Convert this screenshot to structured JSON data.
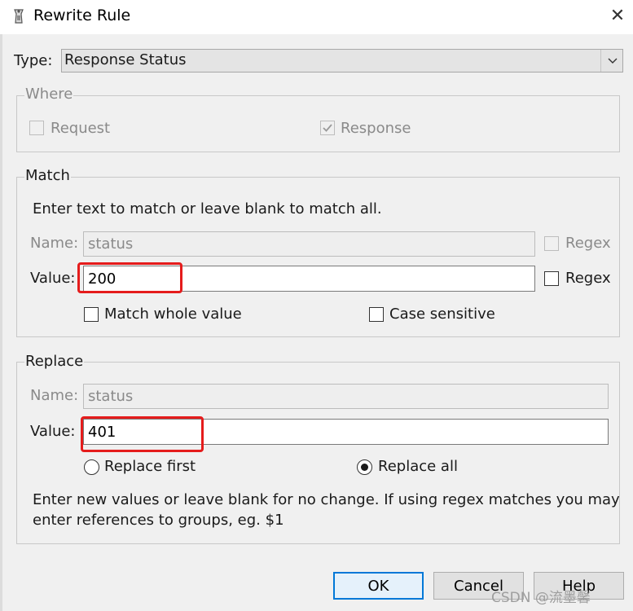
{
  "window": {
    "title": "Rewrite Rule",
    "icon": "wrench-app-icon"
  },
  "type": {
    "label": "Type:",
    "selected": "Response Status"
  },
  "where": {
    "title": "Where",
    "request_label": "Request",
    "request_checked": false,
    "response_label": "Response",
    "response_checked": true
  },
  "match": {
    "title": "Match",
    "hint": "Enter text to match or leave blank to match all.",
    "name_label": "Name:",
    "name_value": "status",
    "name_regex_label": "Regex",
    "value_label": "Value:",
    "value_value": "200",
    "value_regex_label": "Regex",
    "whole_value_label": "Match whole value",
    "case_sensitive_label": "Case sensitive"
  },
  "replace": {
    "title": "Replace",
    "name_label": "Name:",
    "name_value": "status",
    "value_label": "Value:",
    "value_value": "401",
    "replace_first_label": "Replace first",
    "replace_all_label": "Replace all",
    "selected_mode": "replace_all",
    "hint_line1": "Enter new values or leave blank for no change. If using regex matches you may",
    "hint_line2": "enter references to groups, eg. $1"
  },
  "buttons": {
    "ok": "OK",
    "cancel": "Cancel",
    "help": "Help"
  },
  "watermark": "CSDN @流墨馨",
  "colors": {
    "highlight": "#e51c1c",
    "default_button_border": "#0078d7"
  }
}
